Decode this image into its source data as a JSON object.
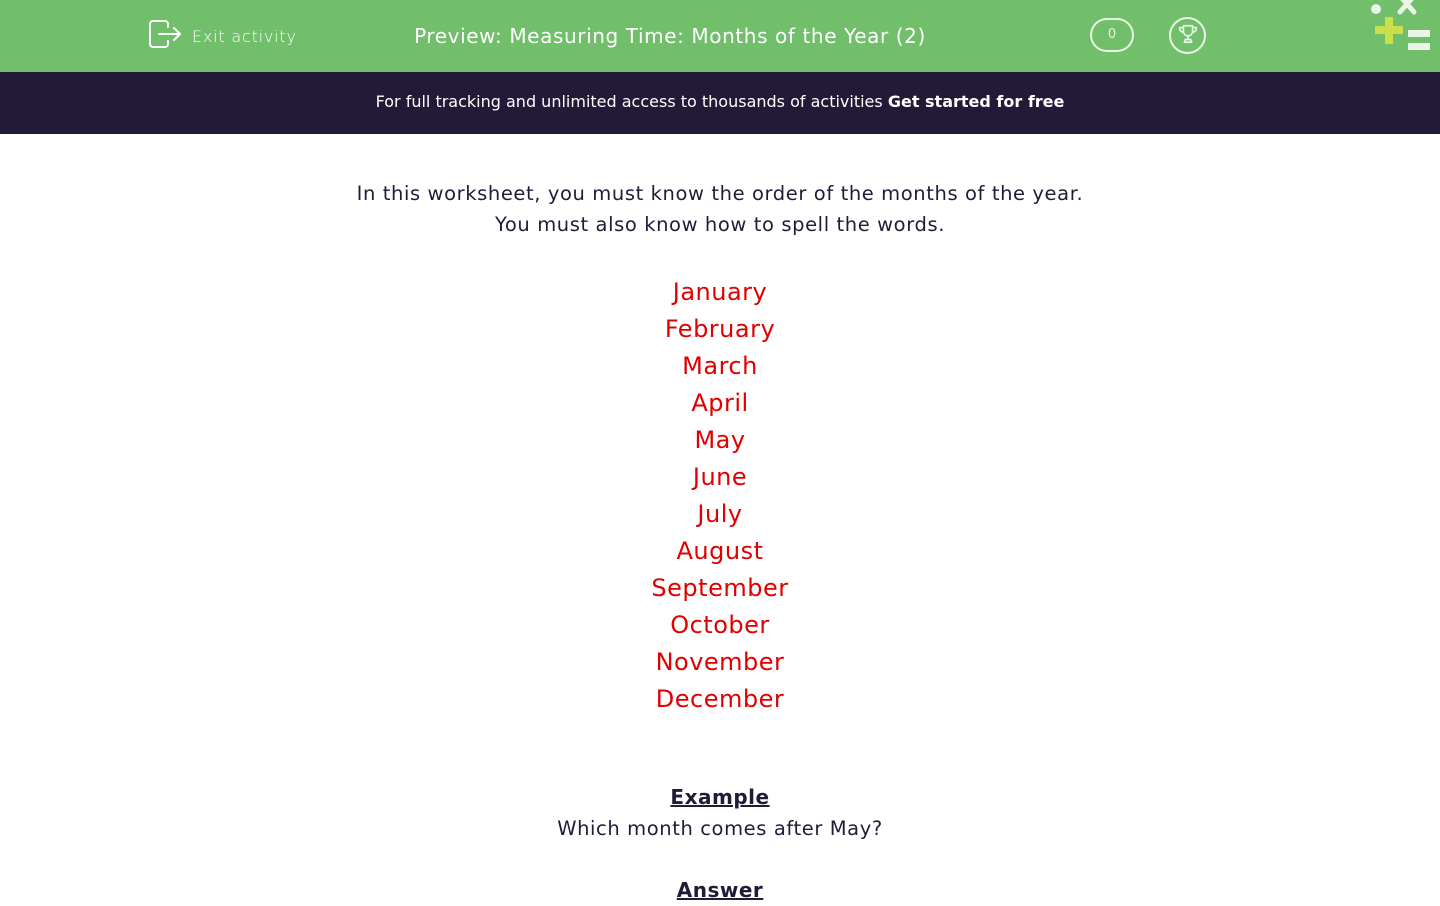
{
  "header": {
    "exit_label": "Exit activity",
    "title": "Preview: Measuring Time: Months of the Year (2)",
    "score": "0",
    "icons": {
      "exit": "exit-icon",
      "trophy": "trophy-icon",
      "logo": "brand-logo-icon"
    },
    "colors": {
      "bar": "#71bf6b",
      "logo_accent": "#c8e04a"
    }
  },
  "banner": {
    "text": "For full tracking and unlimited access to thousands of activities",
    "link": "Get started for free",
    "color": "#231a38"
  },
  "intro": {
    "line1": "In this worksheet, you must know the order of the months of the year.",
    "line2": "You must also know how to spell the words."
  },
  "months": [
    "January",
    "February",
    "March",
    "April",
    "May",
    "June",
    "July",
    "August",
    "September",
    "October",
    "November",
    "December"
  ],
  "months_color": "#e00000",
  "example": {
    "heading": "Example",
    "question": "Which month comes after May?"
  },
  "answer": {
    "heading": "Answer"
  }
}
